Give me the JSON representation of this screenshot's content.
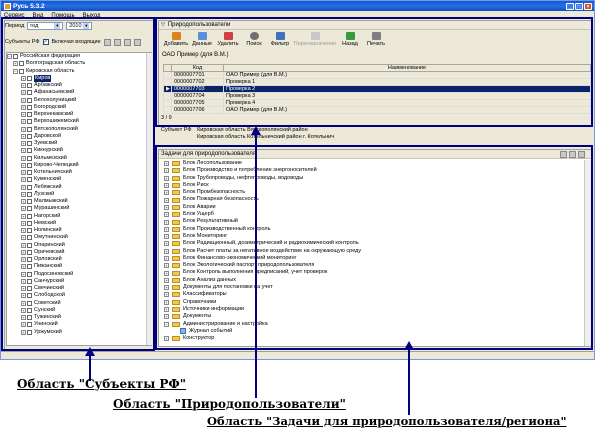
{
  "app": {
    "title": "Русь 5.3.2"
  },
  "menu": [
    "Сервис",
    "Вид",
    "Помощь",
    "Выход"
  ],
  "left": {
    "period_label": "Период",
    "period_value": "год",
    "year_value": "2010",
    "subjects_label": "Субъекты РФ",
    "include_label": "Включая входящие",
    "tree": [
      {
        "label": "Российская федерация",
        "level": 0,
        "exp": "−"
      },
      {
        "label": "Волгоградская область",
        "level": 1,
        "exp": "+"
      },
      {
        "label": "Кировская область",
        "level": 1,
        "exp": "−"
      },
      {
        "label": "Киров",
        "level": 2,
        "exp": "+",
        "sel": true
      },
      {
        "label": "Арбажский",
        "level": 2,
        "exp": "+"
      },
      {
        "label": "Афанасьевский",
        "level": 2,
        "exp": "+"
      },
      {
        "label": "Белохолуницкий",
        "level": 2,
        "exp": "+"
      },
      {
        "label": "Богородский",
        "level": 2,
        "exp": "+"
      },
      {
        "label": "Верхнекамский",
        "level": 2,
        "exp": "+"
      },
      {
        "label": "Верхошижемский",
        "level": 2,
        "exp": "+"
      },
      {
        "label": "Вятскополянский",
        "level": 2,
        "exp": "+"
      },
      {
        "label": "Даровской",
        "level": 2,
        "exp": "+"
      },
      {
        "label": "Зуевский",
        "level": 2,
        "exp": "+"
      },
      {
        "label": "Кикнурский",
        "level": 2,
        "exp": "+"
      },
      {
        "label": "Кильмезский",
        "level": 2,
        "exp": "+"
      },
      {
        "label": "Кирово-Чепецкий",
        "level": 2,
        "exp": "+"
      },
      {
        "label": "Котельничский",
        "level": 2,
        "exp": "+"
      },
      {
        "label": "Куменский",
        "level": 2,
        "exp": "+"
      },
      {
        "label": "Лебяжский",
        "level": 2,
        "exp": "+"
      },
      {
        "label": "Лузский",
        "level": 2,
        "exp": "+"
      },
      {
        "label": "Малмыжский",
        "level": 2,
        "exp": "+"
      },
      {
        "label": "Мурашинский",
        "level": 2,
        "exp": "+"
      },
      {
        "label": "Нагорский",
        "level": 2,
        "exp": "+"
      },
      {
        "label": "Немский",
        "level": 2,
        "exp": "+"
      },
      {
        "label": "Нолинский",
        "level": 2,
        "exp": "+"
      },
      {
        "label": "Омутнинский",
        "level": 2,
        "exp": "+"
      },
      {
        "label": "Опаринский",
        "level": 2,
        "exp": "+"
      },
      {
        "label": "Оричевский",
        "level": 2,
        "exp": "+"
      },
      {
        "label": "Орловский",
        "level": 2,
        "exp": "+"
      },
      {
        "label": "Пижанский",
        "level": 2,
        "exp": "+"
      },
      {
        "label": "Подосиновский",
        "level": 2,
        "exp": "+"
      },
      {
        "label": "Санчурский",
        "level": 2,
        "exp": "+"
      },
      {
        "label": "Свечинский",
        "level": 2,
        "exp": "+"
      },
      {
        "label": "Слободской",
        "level": 2,
        "exp": "+"
      },
      {
        "label": "Советский",
        "level": 2,
        "exp": "+"
      },
      {
        "label": "Сунский",
        "level": 2,
        "exp": "+"
      },
      {
        "label": "Тужинский",
        "level": 2,
        "exp": "+"
      },
      {
        "label": "Унинский",
        "level": 2,
        "exp": "+"
      },
      {
        "label": "Уржумский",
        "level": 2,
        "exp": "+"
      }
    ]
  },
  "users": {
    "group_title": "Природопользователи",
    "toolbar": [
      "Добавить",
      "Данные",
      "Удалить",
      "Поиск",
      "Фильтр",
      "Переназначение",
      "Назад",
      "Печать"
    ],
    "context": "ОАО Пример (для В.М.)",
    "columns": [
      "Код",
      "Наименование"
    ],
    "rows": [
      {
        "code": "0000007701",
        "name": "ОАО Пример (для В.М.)",
        "sel": false
      },
      {
        "code": "0000007702",
        "name": "Проверка 1",
        "sel": false
      },
      {
        "code": "0000007703",
        "name": "Проверка 2",
        "sel": true
      },
      {
        "code": "0000007704",
        "name": "Проверка 3",
        "sel": false
      },
      {
        "code": "0000007705",
        "name": "Проверка 4",
        "sel": false
      },
      {
        "code": "0000007706",
        "name": "ОАО Пример (для В.М.)",
        "sel": false
      }
    ],
    "counter": "3 / 9",
    "subject_label": "Субъект РФ",
    "subject_value": "Кировская область Вятскополянский район",
    "subject_value2": "Кировская область Котельничский район г. Котельнич"
  },
  "tasks": {
    "title": "Задачи для природопользователя",
    "items": [
      {
        "label": "Блок Лесопользование",
        "exp": "+"
      },
      {
        "label": "Блок Производство и потребление энергоносителей",
        "exp": "+"
      },
      {
        "label": "Блок Трубопроводы, нефтепроводы, водоводы",
        "exp": "+"
      },
      {
        "label": "Блок Риск",
        "exp": "+"
      },
      {
        "label": "Блок Промбезопасность",
        "exp": "+"
      },
      {
        "label": "Блок Пожарная безопасность",
        "exp": "+"
      },
      {
        "label": "Блок Аварии",
        "exp": "+"
      },
      {
        "label": "Блок Ущерб",
        "exp": "+"
      },
      {
        "label": "Блок Результативный",
        "exp": "+"
      },
      {
        "label": "Блок Производственный контроль",
        "exp": "+"
      },
      {
        "label": "Блок Мониторинг",
        "exp": "+"
      },
      {
        "label": "Блок Радиационный, дозиметрический и радиохимический контроль",
        "exp": "+"
      },
      {
        "label": "Блок Расчет платы за негативное воздействие на окружающую среду",
        "exp": "+"
      },
      {
        "label": "Блок Финансово-экономический мониторинг",
        "exp": "+"
      },
      {
        "label": "Блок Экологический паспорт природопользователя",
        "exp": "+"
      },
      {
        "label": "Блок Контроль выполнения предписаний, учет проверок",
        "exp": "+"
      },
      {
        "label": "Блок Анализ данных",
        "exp": "+"
      },
      {
        "label": "Документы для постановки на учет",
        "exp": "+"
      },
      {
        "label": "Классификаторы",
        "exp": "+"
      },
      {
        "label": "Справочники",
        "exp": "+"
      },
      {
        "label": "Источники информации",
        "exp": "+"
      },
      {
        "label": "Документы",
        "exp": "+"
      },
      {
        "label": "Администрирование и настройка",
        "exp": "−"
      },
      {
        "label": "Журнал событий",
        "exp": "",
        "child": true
      },
      {
        "label": "Конструктор",
        "exp": "+"
      }
    ]
  },
  "captions": {
    "subjects": "Область \"Субъекты РФ\"",
    "users": "Область \"Природопользователи\"",
    "tasks": "Область \"Задачи для природопользователя/региона\""
  },
  "colors": {
    "highlight": "#000080",
    "selection": "#0a246a",
    "folder": "#f0c850"
  }
}
